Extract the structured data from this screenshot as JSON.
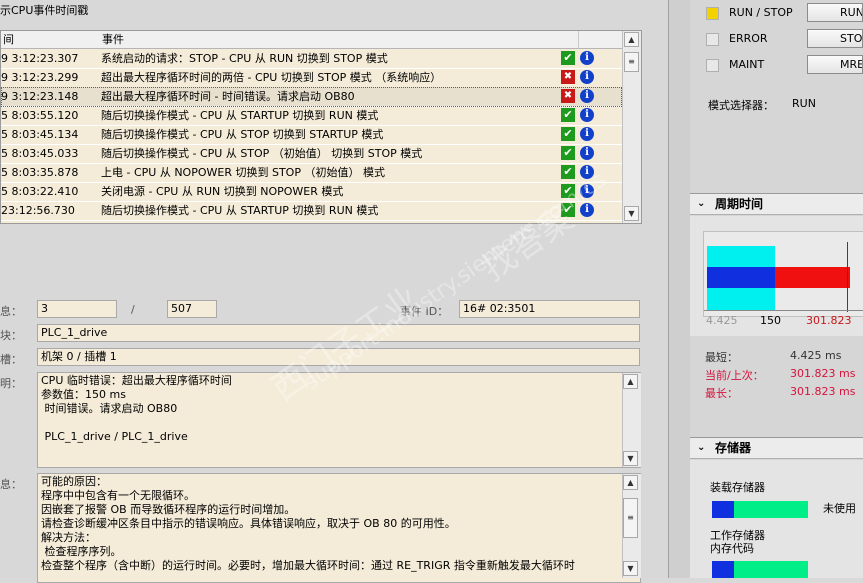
{
  "left_pane": {
    "title": "示CPU事件时间戳",
    "columns": {
      "time": "间",
      "event": "事件"
    },
    "rows": [
      {
        "time": "9 3:12:23.307",
        "event": "系统启动的请求：STOP - CPU 从 RUN 切换到 STOP 模式",
        "status": "ok",
        "selected": false
      },
      {
        "time": "9 3:12:23.299",
        "event": "超出最大程序循环时间的两倍 - CPU 切换到 STOP 模式 （系统响应）",
        "status": "error",
        "selected": false
      },
      {
        "time": "9 3:12:23.148",
        "event": "超出最大程序循环时间 - 时间错误。请求启动 OB80",
        "status": "error",
        "selected": true
      },
      {
        "time": "5 8:03:55.120",
        "event": "随后切换操作模式 - CPU 从 STARTUP 切换到 RUN 模式",
        "status": "ok",
        "selected": false
      },
      {
        "time": "5 8:03:45.134",
        "event": "随后切换操作模式 - CPU 从 STOP 切换到 STARTUP 模式",
        "status": "ok",
        "selected": false
      },
      {
        "time": "5 8:03:45.033",
        "event": "随后切换操作模式 - CPU 从 STOP （初始值） 切换到 STOP 模式",
        "status": "ok",
        "selected": false
      },
      {
        "time": "5 8:03:35.878",
        "event": "上电 - CPU 从 NOPOWER 切换到 STOP （初始值） 模式",
        "status": "ok",
        "selected": false
      },
      {
        "time": "5 8:03:22.410",
        "event": "关闭电源 - CPU 从 RUN 切换到 NOPOWER 模式",
        "status": "ok",
        "selected": false
      },
      {
        "time": "23:12:56.730",
        "event": "随后切换操作模式 - CPU 从 STARTUP 切换到 RUN 模式",
        "status": "ok",
        "selected": false
      }
    ],
    "info_icon": "i",
    "details": {
      "entry_label": "息：",
      "entry_value": "3",
      "slash": "/",
      "entry_total": "507",
      "event_id_label": "事件 ID：",
      "event_id_value": "16# 02:3501",
      "module_label": "块：",
      "module_value": "PLC_1_drive",
      "slot_label": "槽：",
      "slot_value": "机架 0 / 插槽 1",
      "desc_label": "明：",
      "desc_text": "CPU 临时错误：超出最大程序循环时间\n参数值：150 ms\n 时间错误。请求启动 OB80\n\n PLC_1_drive / PLC_1_drive",
      "help_label": "息：",
      "help_text": "可能的原因：\n程序中中包含有一个无限循环。\n因嵌套了报警 OB 而导致循环程序的运行时间增加。\n请检查诊断缓冲区条目中指示的错误响应。具体错误响应，取决于 OB 80 的可用性。\n解决方法：\n 检查程序序列。\n检查整个程序（含中断）的运行时间。必要时，增加最大循环时间：通过 RE_TRIGR 指令重新触发最大循环时"
    }
  },
  "right_pane": {
    "leds": [
      {
        "label": "RUN / STOP",
        "color": "#f2d200",
        "button": "RUN"
      },
      {
        "label": "ERROR",
        "color": "#e8e8e8",
        "button": "STOP"
      },
      {
        "label": "MAINT",
        "color": "#e8e8e8",
        "button": "MRES"
      }
    ],
    "mode_label": "模式选择器：",
    "mode_value": "RUN",
    "cycle_section": {
      "title": "周期时间",
      "min_tick": "4.425",
      "max_cfg_tick": "150",
      "current_tick": "301.823",
      "stats": [
        {
          "label": "最短：",
          "value": "4.425 ms",
          "color": "#333333"
        },
        {
          "label": "当前/上次：",
          "value": "301.823 ms",
          "color": "#d4143c"
        },
        {
          "label": "最长：",
          "value": "301.823 ms",
          "color": "#d4143c"
        }
      ]
    },
    "memory_section": {
      "title": "存储器",
      "load_label": "装载存储器",
      "load_unused": "未使用",
      "work_label": "工作存储器",
      "work_sub_label": "内存代码",
      "usage_fraction": 0.23
    }
  },
  "watermark": [
    "西门子工业",
    "support.industry.siemens.com/cs",
    "找答案"
  ],
  "colors": {
    "ok": "#1e9a1e",
    "error": "#c81818",
    "info": "#1340c8",
    "cyan": "#00f0f0",
    "blue": "#1030e0",
    "red": "#f01010",
    "green": "#00ee88"
  }
}
